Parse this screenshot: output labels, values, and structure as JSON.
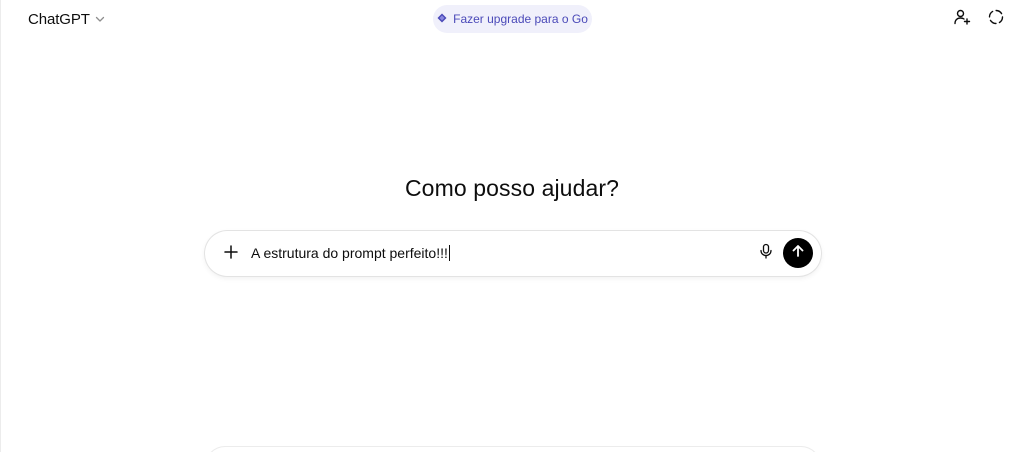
{
  "header": {
    "model_label": "ChatGPT",
    "upgrade_label": "Fazer upgrade para o Go",
    "icons": {
      "model_dropdown": "chevron-down-icon",
      "upgrade": "diamond-icon",
      "add_person": "add-person-icon",
      "temporary_chat": "dashed-circle-icon"
    }
  },
  "hero": {
    "title": "Como posso ajudar?"
  },
  "composer": {
    "text": "A estrutura do prompt perfeito!!!",
    "icons": {
      "attach": "plus-icon",
      "voice": "microphone-icon",
      "send": "arrow-up-icon"
    }
  },
  "colors": {
    "accent_upgrade_bg": "#f0f0fb",
    "accent_upgrade_text": "#4a49b8",
    "send_button": "#000000",
    "text": "#0d0d0d"
  }
}
